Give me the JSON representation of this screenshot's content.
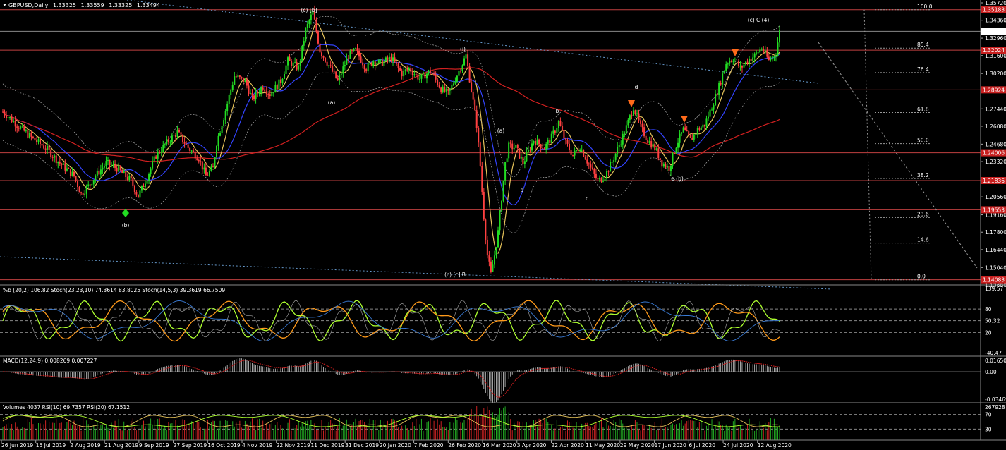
{
  "chart_data": {
    "type": "candlestick",
    "symbol": "GBPUSD,Daily",
    "quote": {
      "open": "1.33325",
      "high": "1.33559",
      "low": "1.33325",
      "close": "1.33494"
    },
    "price_axis": {
      "ticks": [
        "1.35720",
        "1.34360",
        "1.32960",
        "1.31600",
        "1.30200",
        "1.28840",
        "1.27440",
        "1.26080",
        "1.24680",
        "1.23320",
        "1.21920",
        "1.20560",
        "1.19160",
        "1.17800",
        "1.16440",
        "1.15040",
        "1.13680"
      ],
      "range": [
        1.1368,
        1.3572
      ]
    },
    "price_levels": [
      {
        "label": "1.35183",
        "value": 1.35183
      },
      {
        "label": "1.33494",
        "value": 1.33494,
        "current": true
      },
      {
        "label": "1.32024",
        "value": 1.32024
      },
      {
        "label": "1.28924",
        "value": 1.28924
      },
      {
        "label": "1.24006",
        "value": 1.24006
      },
      {
        "label": "1.21836",
        "value": 1.21836
      },
      {
        "label": "1.19553",
        "value": 1.19553
      },
      {
        "label": "1.14083",
        "value": 1.14083
      }
    ],
    "fibonacci": [
      {
        "label": "100.0",
        "value": 1.3518
      },
      {
        "label": "85.4",
        "value": 1.3218
      },
      {
        "label": "76.4",
        "value": 1.3027
      },
      {
        "label": "61.8",
        "value": 1.2715
      },
      {
        "label": "50.0",
        "value": 1.2472
      },
      {
        "label": "38.2",
        "value": 1.22
      },
      {
        "label": "23.6",
        "value": 1.1895
      },
      {
        "label": "14.6",
        "value": 1.1695
      },
      {
        "label": "0.0",
        "value": 1.1408
      }
    ],
    "x_labels": [
      "26 Jun 2019",
      "15 Jul 2019",
      "2 Aug 2019",
      "21 Aug 2019",
      "9 Sep 2019",
      "27 Sep 2019",
      "16 Oct 2019",
      "4 Nov 2019",
      "22 Nov 2019",
      "11 Dec 2019",
      "31 Dec 2019",
      "20 Jan 2020",
      "7 Feb 2020",
      "26 Feb 2020",
      "16 Mar 2020",
      "3 Apr 2020",
      "22 Apr 2020",
      "11 May 2020",
      "29 May 2020",
      "17 Jun 2020",
      "6 Jul 2020",
      "24 Jul 2020",
      "12 Aug 2020"
    ],
    "price_anchors": [
      [
        0,
        1.272
      ],
      [
        8,
        1.262
      ],
      [
        16,
        1.252
      ],
      [
        24,
        1.244
      ],
      [
        32,
        1.232
      ],
      [
        40,
        1.222
      ],
      [
        44,
        1.208
      ],
      [
        48,
        1.214
      ],
      [
        52,
        1.222
      ],
      [
        58,
        1.232
      ],
      [
        64,
        1.228
      ],
      [
        72,
        1.218
      ],
      [
        76,
        1.206
      ],
      [
        80,
        1.218
      ],
      [
        86,
        1.238
      ],
      [
        92,
        1.248
      ],
      [
        98,
        1.256
      ],
      [
        104,
        1.244
      ],
      [
        110,
        1.236
      ],
      [
        114,
        1.222
      ],
      [
        118,
        1.228
      ],
      [
        120,
        1.248
      ],
      [
        124,
        1.268
      ],
      [
        130,
        1.3
      ],
      [
        136,
        1.296
      ],
      [
        140,
        1.282
      ],
      [
        146,
        1.292
      ],
      [
        150,
        1.286
      ],
      [
        156,
        1.296
      ],
      [
        160,
        1.312
      ],
      [
        166,
        1.306
      ],
      [
        170,
        1.336
      ],
      [
        174,
        1.35
      ],
      [
        178,
        1.32
      ],
      [
        184,
        1.306
      ],
      [
        188,
        1.296
      ],
      [
        194,
        1.316
      ],
      [
        198,
        1.32
      ],
      [
        204,
        1.306
      ],
      [
        208,
        1.312
      ],
      [
        212,
        1.31
      ],
      [
        218,
        1.314
      ],
      [
        224,
        1.302
      ],
      [
        228,
        1.306
      ],
      [
        234,
        1.298
      ],
      [
        240,
        1.304
      ],
      [
        246,
        1.29
      ],
      [
        250,
        1.286
      ],
      [
        256,
        1.304
      ],
      [
        260,
        1.316
      ],
      [
        264,
        1.28
      ],
      [
        266,
        1.262
      ],
      [
        268,
        1.23
      ],
      [
        270,
        1.19
      ],
      [
        272,
        1.16
      ],
      [
        274,
        1.145
      ],
      [
        276,
        1.16
      ],
      [
        278,
        1.178
      ],
      [
        280,
        1.205
      ],
      [
        282,
        1.232
      ],
      [
        284,
        1.245
      ],
      [
        288,
        1.244
      ],
      [
        292,
        1.232
      ],
      [
        298,
        1.25
      ],
      [
        304,
        1.244
      ],
      [
        308,
        1.252
      ],
      [
        312,
        1.264
      ],
      [
        316,
        1.248
      ],
      [
        320,
        1.238
      ],
      [
        324,
        1.245
      ],
      [
        330,
        1.228
      ],
      [
        334,
        1.218
      ],
      [
        338,
        1.222
      ],
      [
        342,
        1.233
      ],
      [
        346,
        1.246
      ],
      [
        350,
        1.26
      ],
      [
        354,
        1.276
      ],
      [
        358,
        1.26
      ],
      [
        362,
        1.25
      ],
      [
        366,
        1.244
      ],
      [
        370,
        1.232
      ],
      [
        374,
        1.228
      ],
      [
        378,
        1.246
      ],
      [
        382,
        1.258
      ],
      [
        386,
        1.25
      ],
      [
        390,
        1.258
      ],
      [
        394,
        1.262
      ],
      [
        398,
        1.276
      ],
      [
        402,
        1.292
      ],
      [
        406,
        1.31
      ],
      [
        410,
        1.314
      ],
      [
        414,
        1.306
      ],
      [
        418,
        1.312
      ],
      [
        422,
        1.316
      ],
      [
        426,
        1.322
      ],
      [
        430,
        1.312
      ],
      [
        434,
        1.318
      ],
      [
        436,
        1.335
      ]
    ],
    "annotations": [
      "(c) [b]",
      "(i)",
      "(c) [c] B",
      "(a)",
      "b",
      "d",
      "(a)",
      "a",
      "c",
      "e (b)",
      "(b)",
      "(c) C (4)"
    ],
    "indicators": [
      {
        "title": "%b (20,2) 106.82  Stoch(23,23,10) 74.3614 83.8025  Stoch(14,5,3) 39.3619 66.7509",
        "axis_labels": [
          "139.57",
          "80",
          "50.32",
          "20",
          "-40.47"
        ],
        "range": [
          -40.47,
          139.57
        ]
      },
      {
        "title": "MACD(12,24,9) 0.008269 0.007227",
        "axis_labels": [
          "0.016502",
          "0.00",
          "-0.034699"
        ],
        "range": [
          -0.034699,
          0.016502
        ]
      },
      {
        "title": "Volumes 4037  RSI(10) 69.7357  RSI(20) 67.1512",
        "axis_labels": [
          "267928",
          "70",
          "30"
        ]
      }
    ]
  }
}
